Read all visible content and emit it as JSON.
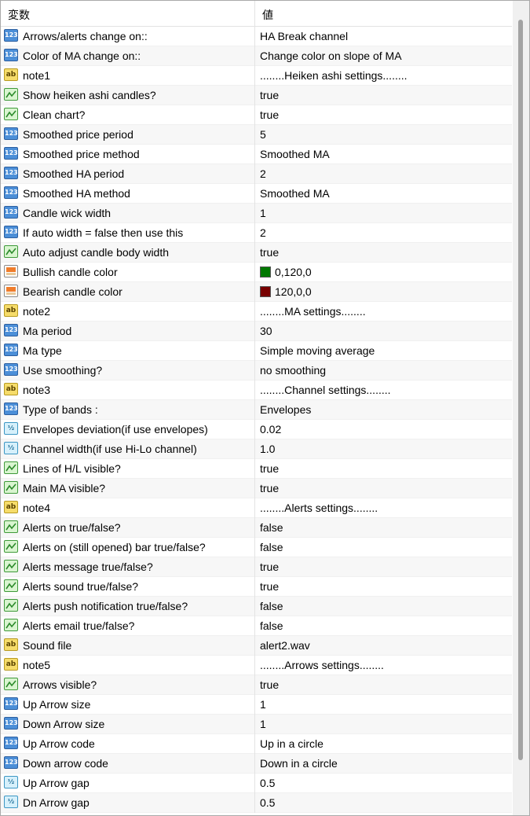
{
  "header": {
    "col_name": "変数",
    "col_value": "値"
  },
  "rows": [
    {
      "type": "int",
      "icon": "123",
      "name": "Arrows/alerts change on::",
      "value": "HA Break channel"
    },
    {
      "type": "int",
      "icon": "123",
      "name": "Color of MA change on::",
      "value": "Change color on slope of MA"
    },
    {
      "type": "str",
      "icon": "ab",
      "name": "note1",
      "value": "........Heiken ashi settings........"
    },
    {
      "type": "bool",
      "icon": "bool",
      "name": "Show  heiken ashi candles?",
      "value": "true"
    },
    {
      "type": "bool",
      "icon": "bool",
      "name": "Clean chart?",
      "value": "true"
    },
    {
      "type": "int",
      "icon": "123",
      "name": "Smoothed price period",
      "value": "5"
    },
    {
      "type": "int",
      "icon": "123",
      "name": "Smoothed price method",
      "value": "Smoothed MA"
    },
    {
      "type": "int",
      "icon": "123",
      "name": "Smoothed HA period",
      "value": "2"
    },
    {
      "type": "int",
      "icon": "123",
      "name": "Smoothed HA method",
      "value": "Smoothed MA"
    },
    {
      "type": "int",
      "icon": "123",
      "name": "Candle wick width",
      "value": "1"
    },
    {
      "type": "int",
      "icon": "123",
      "name": "If auto width = false then use this",
      "value": "2"
    },
    {
      "type": "bool",
      "icon": "bool",
      "name": "Auto adjust candle body width",
      "value": "true"
    },
    {
      "type": "clr",
      "icon": "color",
      "name": "Bullish candle  color",
      "value": "0,120,0",
      "swatch": "#007800"
    },
    {
      "type": "clr",
      "icon": "color",
      "name": "Bearish candle  color",
      "value": "120,0,0",
      "swatch": "#780000"
    },
    {
      "type": "str",
      "icon": "ab",
      "name": "note2",
      "value": "........MA settings........"
    },
    {
      "type": "int",
      "icon": "123",
      "name": "Ma period",
      "value": "30"
    },
    {
      "type": "int",
      "icon": "123",
      "name": "Ma type",
      "value": "Simple moving average"
    },
    {
      "type": "int",
      "icon": "123",
      "name": "Use smoothing?",
      "value": "no smoothing"
    },
    {
      "type": "str",
      "icon": "ab",
      "name": "note3",
      "value": "........Channel settings........"
    },
    {
      "type": "int",
      "icon": "123",
      "name": "Type of bands :",
      "value": "Envelopes"
    },
    {
      "type": "dbl",
      "icon": "1/2",
      "name": "Envelopes deviation(if use envelopes)",
      "value": "0.02"
    },
    {
      "type": "dbl",
      "icon": "1/2",
      "name": "Channel width(if use Hi-Lo channel)",
      "value": "1.0"
    },
    {
      "type": "bool",
      "icon": "bool",
      "name": "Lines of H/L visible?",
      "value": "true"
    },
    {
      "type": "bool",
      "icon": "bool",
      "name": "Main MA visible?",
      "value": "true"
    },
    {
      "type": "str",
      "icon": "ab",
      "name": "note4",
      "value": "........Alerts settings........"
    },
    {
      "type": "bool",
      "icon": "bool",
      "name": "Alerts on true/false?",
      "value": "false"
    },
    {
      "type": "bool",
      "icon": "bool",
      "name": "Alerts on (still opened) bar true/false?",
      "value": "false"
    },
    {
      "type": "bool",
      "icon": "bool",
      "name": "Alerts message true/false?",
      "value": "true"
    },
    {
      "type": "bool",
      "icon": "bool",
      "name": "Alerts sound true/false?",
      "value": "true"
    },
    {
      "type": "bool",
      "icon": "bool",
      "name": "Alerts push notification true/false?",
      "value": "false"
    },
    {
      "type": "bool",
      "icon": "bool",
      "name": "Alerts email true/false?",
      "value": "false"
    },
    {
      "type": "str",
      "icon": "ab",
      "name": "Sound file",
      "value": "alert2.wav"
    },
    {
      "type": "str",
      "icon": "ab",
      "name": "note5",
      "value": "........Arrows settings........"
    },
    {
      "type": "bool",
      "icon": "bool",
      "name": "Arrows visible?",
      "value": "true"
    },
    {
      "type": "int",
      "icon": "123",
      "name": "Up Arrow size",
      "value": "1"
    },
    {
      "type": "int",
      "icon": "123",
      "name": "Down Arrow size",
      "value": "1"
    },
    {
      "type": "int",
      "icon": "123",
      "name": "Up Arrow code",
      "value": "Up in a circle"
    },
    {
      "type": "int",
      "icon": "123",
      "name": "Down arrow code",
      "value": "Down in a circle"
    },
    {
      "type": "dbl",
      "icon": "1/2",
      "name": "Up Arrow gap",
      "value": "0.5"
    },
    {
      "type": "dbl",
      "icon": "1/2",
      "name": "Dn Arrow gap",
      "value": "0.5"
    }
  ]
}
